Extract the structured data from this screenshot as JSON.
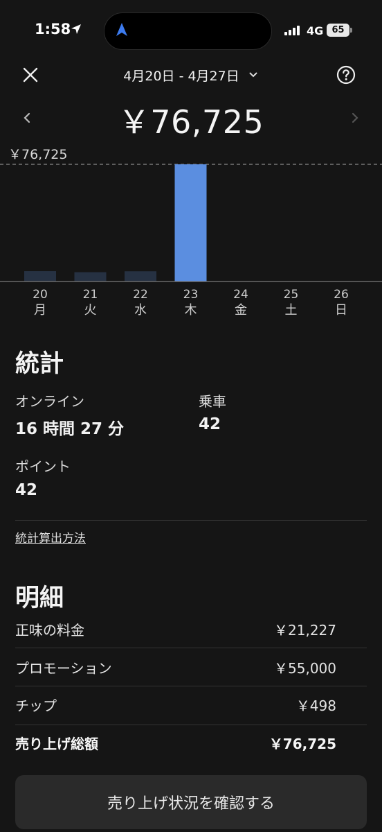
{
  "status_bar": {
    "time": "1:58",
    "network": "4G",
    "battery": "65"
  },
  "header": {
    "date_range": "4月20日 - 4月27日"
  },
  "summary": {
    "total": "￥76,725"
  },
  "colors": {
    "active_bar": "#5b8ee0",
    "inactive_bar": "#263142",
    "background": "#151515"
  },
  "icons": {
    "close": "close-icon",
    "dropdown": "chevron-down-icon",
    "help": "help-icon",
    "prev": "chevron-left-icon",
    "next": "chevron-right-icon",
    "location": "location-arrow-icon",
    "navigation": "navigation-arrow-icon"
  },
  "chart_data": {
    "type": "bar",
    "max_label": "￥76,725",
    "categories": [
      "20",
      "21",
      "22",
      "23",
      "24",
      "25",
      "26"
    ],
    "weekdays": [
      "月",
      "火",
      "水",
      "木",
      "金",
      "土",
      "日"
    ],
    "values": [
      6800,
      6100,
      6700,
      76725,
      0,
      0,
      0
    ],
    "ylim": [
      0,
      76725
    ],
    "highlight_index": 3,
    "gridline": "dashed at max"
  },
  "stats": {
    "title": "統計",
    "items": [
      {
        "label": "オンライン",
        "value": "16 時間 27 分"
      },
      {
        "label": "乗車",
        "value": "42"
      },
      {
        "label": "ポイント",
        "value": "42"
      }
    ],
    "link": "統計算出方法"
  },
  "breakdown": {
    "title": "明細",
    "rows": [
      {
        "label": "正味の料金",
        "value": "￥21,227"
      },
      {
        "label": "プロモーション",
        "value": "￥55,000"
      },
      {
        "label": "チップ",
        "value": "￥498"
      },
      {
        "label": "売り上げ総額",
        "value": "￥76,725"
      }
    ]
  },
  "cta": {
    "label": "売り上げ状況を確認する"
  }
}
